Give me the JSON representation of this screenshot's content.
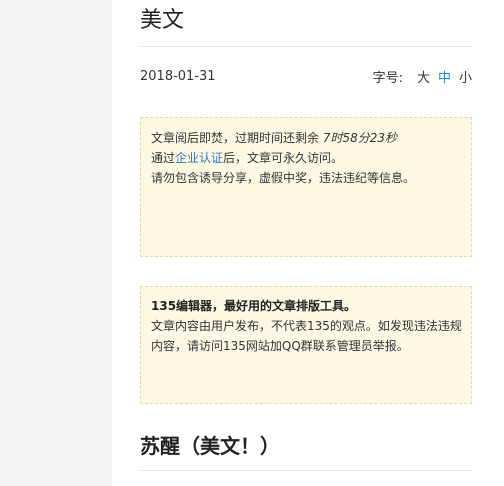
{
  "header": {
    "title": "美文"
  },
  "meta": {
    "date": "2018-01-31",
    "font_size_label": "字号:",
    "sizes": [
      "大",
      "中",
      "小"
    ],
    "active_size": "中"
  },
  "notice_expiry": {
    "prefix": "文章阅后即焚，过期时间还剩余 ",
    "countdown": "7时58分23秒",
    "line2_before": "通过",
    "link": "企业认证",
    "line2_after": "后，文章可永久访问。",
    "line3": "请勿包含诱导分享，虚假中奖，违法违纪等信息。"
  },
  "notice_disclaimer": {
    "headline": "135编辑器，最好用的文章排版工具。",
    "body": "文章内容由用户发布，不代表135的观点。如发现违法违规内容，请访问135网站加QQ群联系管理员举报。"
  },
  "article": {
    "title": "苏醒（美文！）"
  },
  "colors": {
    "accent": "#1e88e5",
    "link": "#2b7bbb",
    "notice_bg": "#fdf8e4",
    "notice_border": "#e7d9a6",
    "gutter": "#f2f2f2"
  }
}
